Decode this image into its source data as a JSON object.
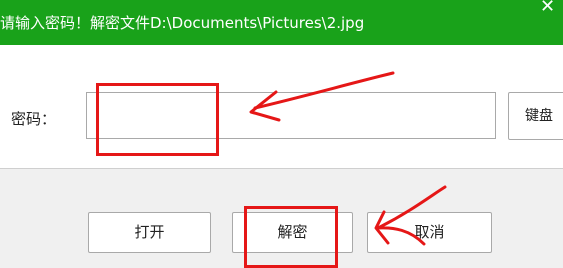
{
  "dialog": {
    "title": "请输入密码！解密文件D:\\Documents\\Pictures\\2.jpg",
    "close_glyph": "✕"
  },
  "form": {
    "password_label": "密码：",
    "password_value": "",
    "keyboard_label": "键盘"
  },
  "buttons": {
    "open": "打开",
    "decrypt": "解密",
    "cancel": "取消"
  },
  "colors": {
    "titlebar": "#19a21a",
    "annotation": "#e51717"
  },
  "icons": {
    "close": "close-icon"
  }
}
